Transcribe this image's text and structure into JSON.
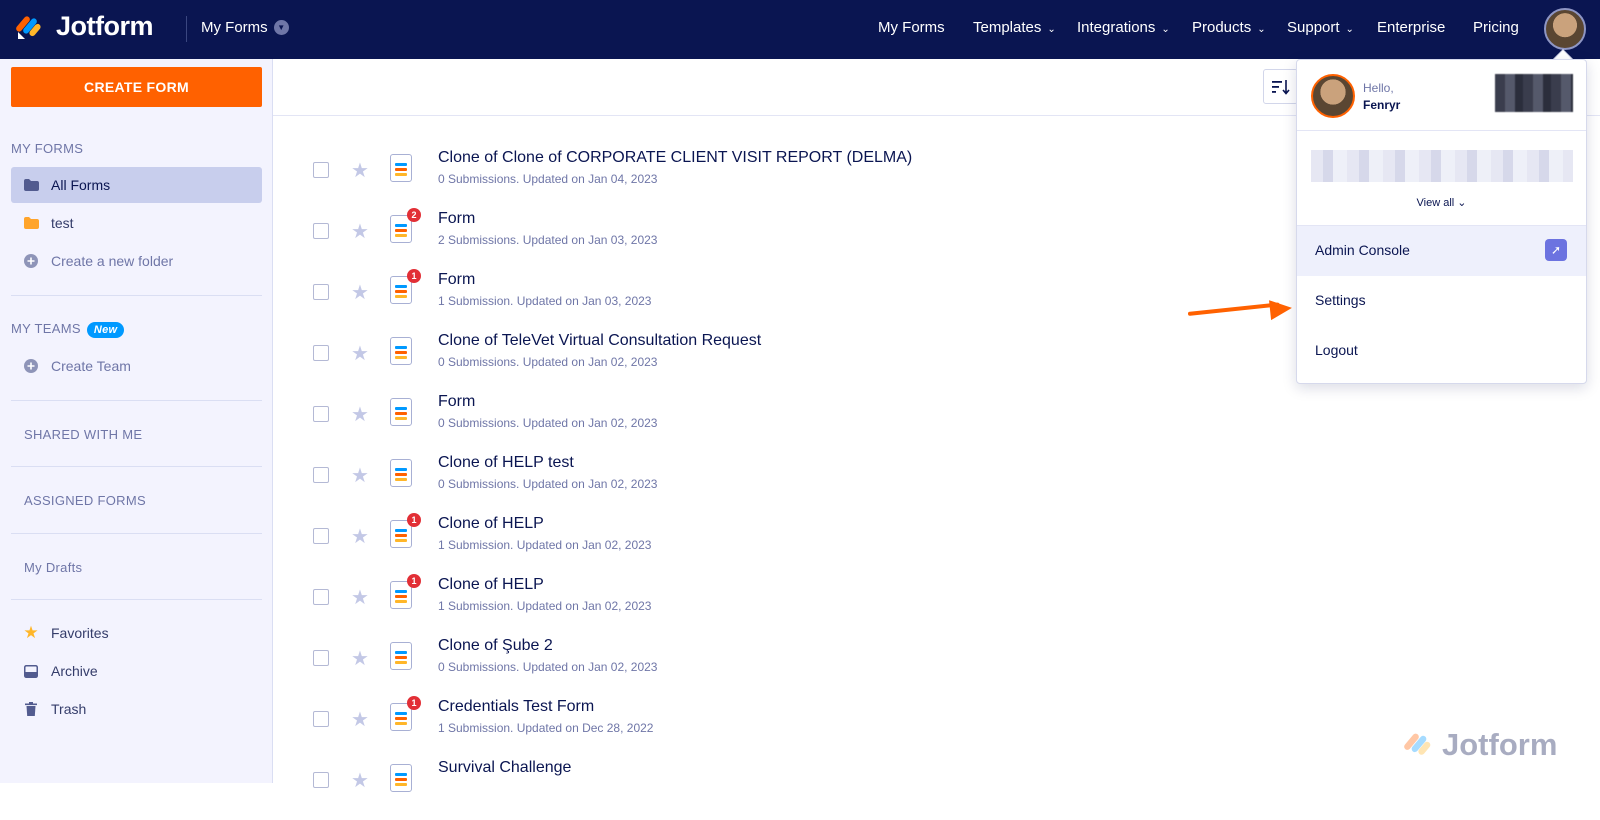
{
  "app": {
    "logo_text": "Jotform"
  },
  "topbar": {
    "myforms_dropdown": "My Forms",
    "nav": [
      "My Forms",
      "Templates",
      "Integrations",
      "Products",
      "Support",
      "Enterprise",
      "Pricing"
    ]
  },
  "sidebar": {
    "create_button": "CREATE FORM",
    "my_forms_heading": "MY FORMS",
    "folders": [
      "All Forms",
      "test"
    ],
    "create_folder": "Create a new folder",
    "my_teams_heading": "MY TEAMS",
    "new_badge": "New",
    "create_team": "Create Team",
    "shared_with_me": "SHARED WITH ME",
    "assigned_forms": "ASSIGNED FORMS",
    "my_drafts": "My Drafts",
    "favorites": "Favorites",
    "archive": "Archive",
    "trash": "Trash"
  },
  "forms": [
    {
      "title": "Clone of Clone of CORPORATE CLIENT VISIT REPORT (DELMA)",
      "meta": "0 Submissions. Updated on Jan 04, 2023",
      "badge": ""
    },
    {
      "title": "Form",
      "meta": "2 Submissions. Updated on Jan 03, 2023",
      "badge": "2"
    },
    {
      "title": "Form",
      "meta": "1 Submission. Updated on Jan 03, 2023",
      "badge": "1"
    },
    {
      "title": "Clone of TeleVet Virtual Consultation Request",
      "meta": "0 Submissions. Updated on Jan 02, 2023",
      "badge": ""
    },
    {
      "title": "Form",
      "meta": "0 Submissions. Updated on Jan 02, 2023",
      "badge": ""
    },
    {
      "title": "Clone of HELP test",
      "meta": "0 Submissions. Updated on Jan 02, 2023",
      "badge": ""
    },
    {
      "title": "Clone of HELP",
      "meta": "1 Submission. Updated on Jan 02, 2023",
      "badge": "1"
    },
    {
      "title": "Clone of HELP",
      "meta": "1 Submission. Updated on Jan 02, 2023",
      "badge": "1"
    },
    {
      "title": "Clone of Şube 2",
      "meta": "0 Submissions. Updated on Jan 02, 2023",
      "badge": ""
    },
    {
      "title": "Credentials Test Form",
      "meta": "1 Submission. Updated on Dec 28, 2022",
      "badge": "1"
    },
    {
      "title": "Survival Challenge",
      "meta": "",
      "badge": ""
    }
  ],
  "user_menu": {
    "hello": "Hello,",
    "name": "Fenryr",
    "view_all": "View all",
    "admin_console": "Admin Console",
    "settings": "Settings",
    "logout": "Logout"
  },
  "colors": {
    "nav_bg": "#0a1551",
    "accent": "#ff6100",
    "sidebar_bg": "#f3f3fe"
  }
}
